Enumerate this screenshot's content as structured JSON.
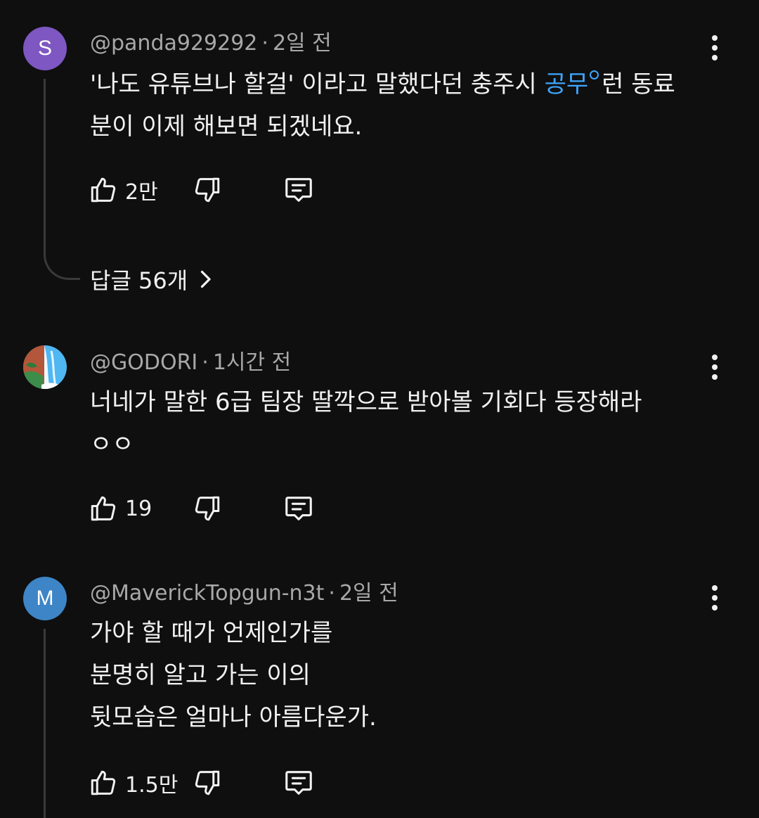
{
  "comments": [
    {
      "avatar_letter": "S",
      "avatar_color": "#7e57c2",
      "handle": "@panda929292",
      "separator": "·",
      "time": "2일 전",
      "text_before": "'나도 유튜브나 할걸' 이라고 말했다던 충주시 ",
      "link_text": "공무",
      "text_after": "런 동료\n분이 이제 해보면 되겠네요.",
      "likes": "2만",
      "replies_label": "답글 56개"
    },
    {
      "avatar_icon": "waterfall-avatar-icon",
      "handle": "@GODORI",
      "separator": "·",
      "time": "1시간 전",
      "text": "너네가 말한 6급 팀장 딸깍으로 받아볼 기회다 등장해라\nㅇㅇ",
      "likes": "19"
    },
    {
      "avatar_letter": "M",
      "avatar_color": "#3d85c6",
      "handle": "@MaverickTopgun-n3t",
      "separator": "·",
      "time": "2일 전",
      "text": "가야 할 때가 언제인가를\n분명히 알고 가는 이의\n뒷모습은 얼마나 아름다운가.",
      "likes": "1.5만"
    }
  ],
  "icons": {
    "like": "thumbs-up-icon",
    "dislike": "thumbs-down-icon",
    "reply": "reply-comment-icon",
    "menu": "more-vertical-icon",
    "chevron": "chevron-right-icon"
  },
  "colors": {
    "background": "#0f0f0f",
    "text": "#f1f1f1",
    "meta": "#a8a8a8",
    "link": "#3ea6ff"
  }
}
